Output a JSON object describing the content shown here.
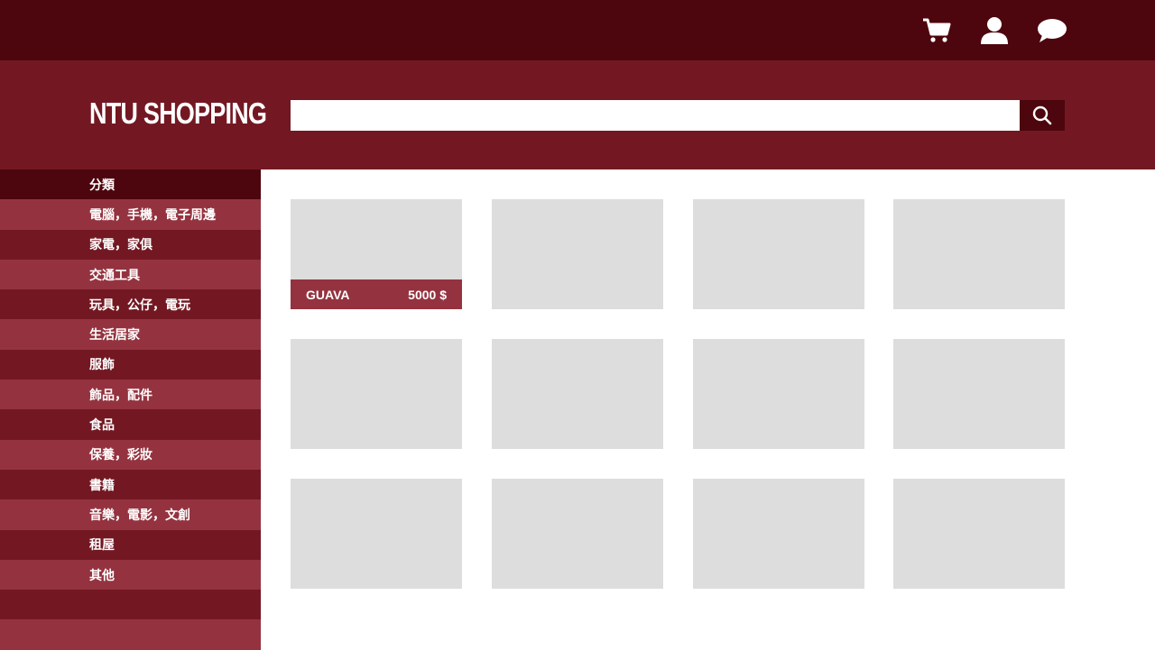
{
  "topbar": {
    "icons": [
      "cart-icon",
      "user-icon",
      "chat-icon"
    ]
  },
  "header": {
    "logo": "NTU SHOPPING",
    "search": {
      "placeholder": "",
      "value": ""
    },
    "search_icon": "search-icon"
  },
  "sidebar": {
    "heading": "分類",
    "items": [
      "電腦，手機，電子周邊",
      "家電，家俱",
      "交通工具",
      "玩具，公仔，電玩",
      "生活居家",
      "服飾",
      "飾品，配件",
      "食品",
      "保養，彩妝",
      "書籍",
      "音樂，電影，文創",
      "租屋",
      "其他"
    ]
  },
  "products": [
    {
      "name": "GUAVA",
      "price": "5000 $"
    },
    {
      "name": "",
      "price": ""
    },
    {
      "name": "",
      "price": ""
    },
    {
      "name": "",
      "price": ""
    },
    {
      "name": "",
      "price": ""
    },
    {
      "name": "",
      "price": ""
    },
    {
      "name": "",
      "price": ""
    },
    {
      "name": "",
      "price": ""
    },
    {
      "name": "",
      "price": ""
    },
    {
      "name": "",
      "price": ""
    },
    {
      "name": "",
      "price": ""
    },
    {
      "name": "",
      "price": ""
    }
  ],
  "colors": {
    "topbar": "#4d060d",
    "header": "#731822",
    "accent_light": "#94333f",
    "placeholder_gray": "#dddddd"
  }
}
